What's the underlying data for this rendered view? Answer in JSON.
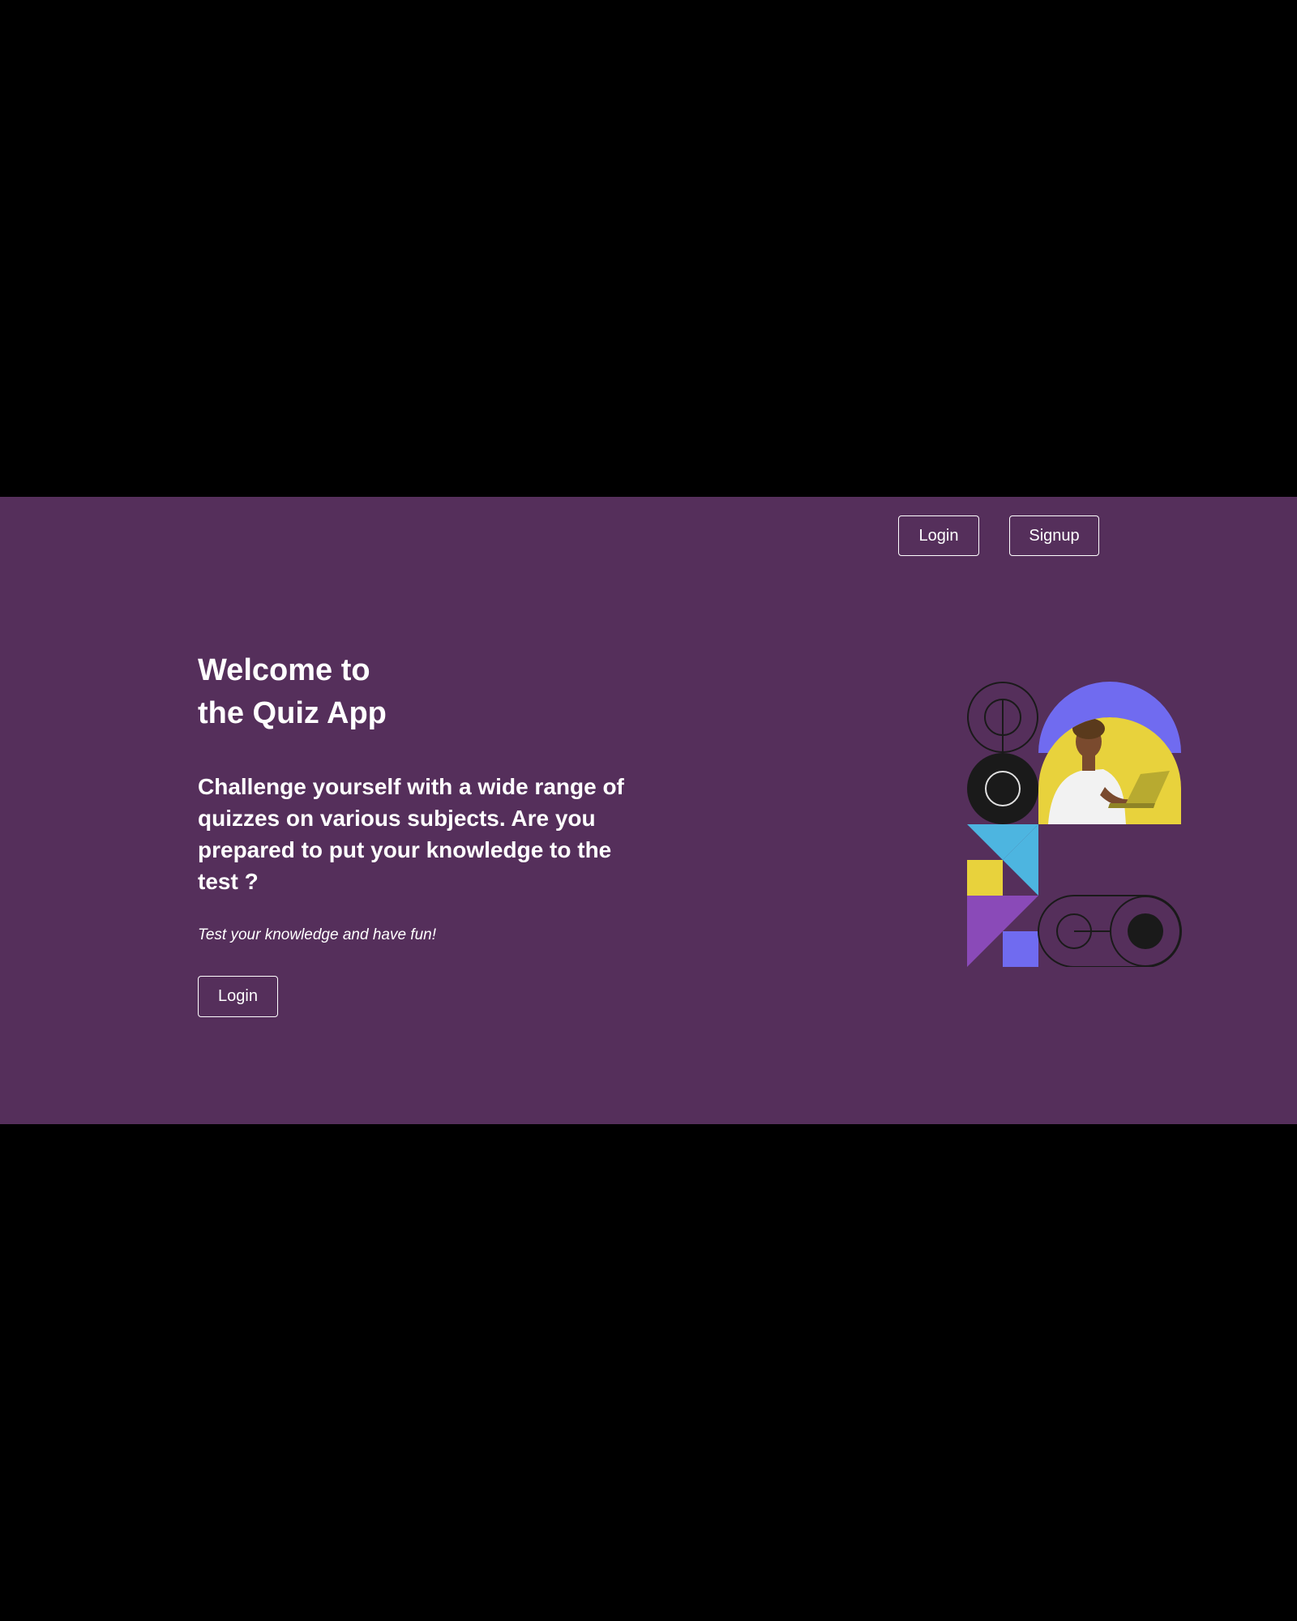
{
  "nav": {
    "login_label": "Login",
    "signup_label": "Signup"
  },
  "hero": {
    "title_line1": "Welcome to",
    "title_line2": "the Quiz App",
    "subtitle": "Challenge yourself with a wide range of quizzes on various subjects. Are you prepared to put your knowledge to the test ?",
    "tagline": "Test your knowledge and have fun!",
    "cta_label": "Login"
  },
  "colors": {
    "background": "#552f5b",
    "page_backdrop": "#000000",
    "accent_periwinkle": "#706bf0",
    "accent_yellow": "#e8d23c",
    "accent_cyan": "#4db5e0",
    "accent_purple": "#8a4ab8",
    "text": "#ffffff"
  }
}
